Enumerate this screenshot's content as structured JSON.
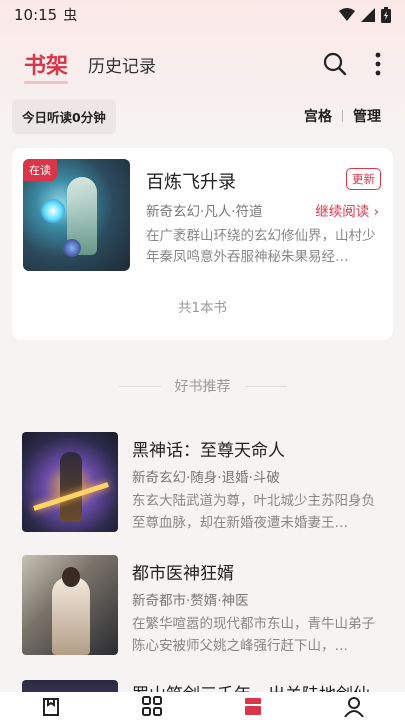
{
  "status_bar": {
    "time": "10:15",
    "carrier_glyph": "虫"
  },
  "header": {
    "tab_shelf": "书架",
    "tab_history": "历史记录"
  },
  "subbar": {
    "today_reading": "今日听读0分钟",
    "grid_label": "宫格",
    "manage_label": "管理"
  },
  "shelf": {
    "books": [
      {
        "badge": "在读",
        "title": "百炼飞升录",
        "update_badge": "更新",
        "meta": "新奇玄幻·凡人·符道",
        "continue_label": "继续阅读 ›",
        "desc": "在广袤群山环绕的玄幻修仙界，山村少年秦凤鸣意外吞服神秘朱果易经…"
      }
    ],
    "total": "共1本书"
  },
  "recommend": {
    "heading": "好书推荐",
    "items": [
      {
        "title": "黑神话：至尊天命人",
        "meta": "新奇玄幻·随身·退婚·斗破",
        "desc": "东玄大陆武道为尊，叶北城少主苏阳身负至尊血脉，却在新婚夜遭未婚妻王…"
      },
      {
        "title": "都市医神狂婿",
        "meta": "新奇都市·赘婿·神医",
        "desc": "在繁华喧嚣的现代都市东山，青牛山弟子陈心安被师父姚之峰强行赶下山，…"
      },
      {
        "title": "罗山筑剑三千年，出关陆地剑仙"
      }
    ]
  },
  "colors": {
    "accent": "#d9364a"
  }
}
